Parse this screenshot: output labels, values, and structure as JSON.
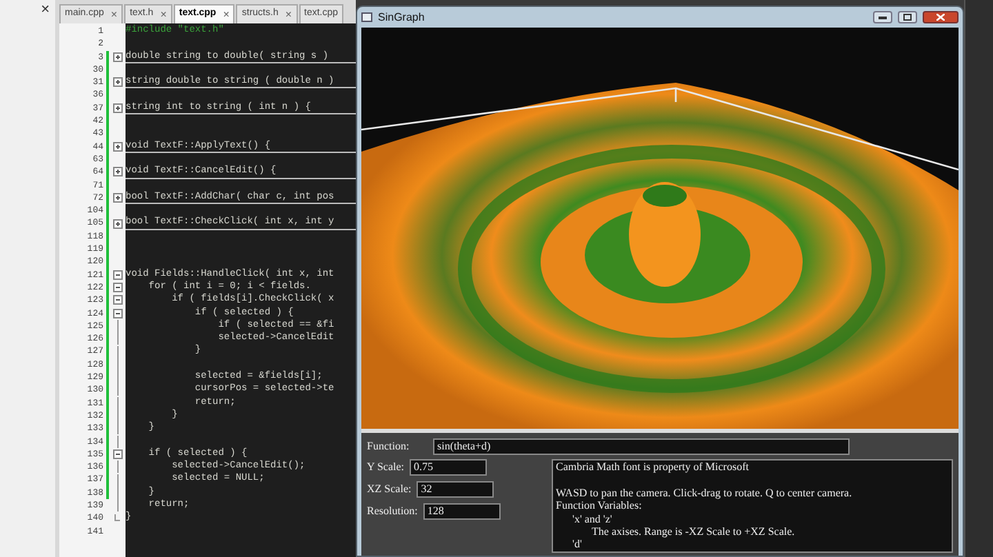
{
  "editor": {
    "close_label": "×",
    "tabs": [
      {
        "label": "main.cpp",
        "close": "×",
        "selected": false
      },
      {
        "label": "text.h",
        "close": "×",
        "selected": false
      },
      {
        "label": "text.cpp",
        "close": "×",
        "selected": true
      },
      {
        "label": "structs.h",
        "close": "×",
        "selected": false
      },
      {
        "label": "text.cpp",
        "selected": false
      }
    ],
    "lines": [
      {
        "n": "1",
        "code": "#include \"text.h\"",
        "kind": "preprocessor",
        "changed": false
      },
      {
        "n": "2",
        "kind": "plain",
        "changed": false
      },
      {
        "n": "3",
        "code": "double string to double( string s )",
        "kind": "collapsed",
        "changed": true
      },
      {
        "n": "30",
        "kind": "plain",
        "changed": true
      },
      {
        "n": "31",
        "code": "string double to string ( double n )",
        "kind": "collapsed",
        "changed": true
      },
      {
        "n": "36",
        "kind": "plain",
        "changed": true
      },
      {
        "n": "37",
        "code": "string int to string ( int n ) {",
        "kind": "collapsed",
        "changed": true
      },
      {
        "n": "42",
        "kind": "plain",
        "changed": true
      },
      {
        "n": "43",
        "kind": "plain",
        "changed": true
      },
      {
        "n": "44",
        "code": "void TextF::ApplyText() {",
        "kind": "collapsed",
        "changed": true
      },
      {
        "n": "63",
        "kind": "plain",
        "changed": true
      },
      {
        "n": "64",
        "code": "void TextF::CancelEdit() {",
        "kind": "collapsed",
        "changed": true
      },
      {
        "n": "71",
        "kind": "plain",
        "changed": true
      },
      {
        "n": "72",
        "code": "bool TextF::AddChar( char c, int pos",
        "kind": "collapsed",
        "changed": true
      },
      {
        "n": "104",
        "kind": "plain",
        "changed": true
      },
      {
        "n": "105",
        "code": "bool TextF::CheckClick( int x, int y",
        "kind": "collapsed",
        "changed": true
      },
      {
        "n": "118",
        "kind": "plain",
        "changed": true
      },
      {
        "n": "119",
        "kind": "plain",
        "changed": true
      },
      {
        "n": "120",
        "kind": "plain",
        "changed": true
      },
      {
        "n": "121",
        "code": "void Fields::HandleClick( int x, int",
        "kind": "expanded",
        "changed": true
      },
      {
        "n": "122",
        "code": "    for ( int i = 0; i < fields.",
        "kind": "expanded",
        "changed": true
      },
      {
        "n": "123",
        "code": "        if ( fields[i].CheckClick( x",
        "kind": "expanded",
        "changed": true
      },
      {
        "n": "124",
        "code": "            if ( selected ) {",
        "kind": "expanded",
        "changed": true
      },
      {
        "n": "125",
        "code": "                if ( selected == &fi",
        "kind": "nested",
        "changed": true
      },
      {
        "n": "126",
        "code": "                selected->CancelEdit",
        "kind": "nested",
        "changed": true
      },
      {
        "n": "127",
        "code": "            }",
        "kind": "nested",
        "changed": true
      },
      {
        "n": "128",
        "kind": "nested",
        "changed": true
      },
      {
        "n": "129",
        "code": "            selected = &fields[i];",
        "kind": "nested",
        "changed": true
      },
      {
        "n": "130",
        "code": "            cursorPos = selected->te",
        "kind": "nested",
        "changed": true
      },
      {
        "n": "131",
        "code": "            return;",
        "kind": "nested",
        "changed": true
      },
      {
        "n": "132",
        "code": "        }",
        "kind": "nested",
        "changed": true
      },
      {
        "n": "133",
        "code": "    }",
        "kind": "nested",
        "changed": true
      },
      {
        "n": "134",
        "kind": "nested",
        "changed": true
      },
      {
        "n": "135",
        "code": "    if ( selected ) {",
        "kind": "expanded",
        "changed": true
      },
      {
        "n": "136",
        "code": "        selected->CancelEdit();",
        "kind": "nested",
        "changed": true
      },
      {
        "n": "137",
        "code": "        selected = NULL;",
        "kind": "nested",
        "changed": true
      },
      {
        "n": "138",
        "code": "    }",
        "kind": "nested",
        "changed": true
      },
      {
        "n": "139",
        "code": "    return;",
        "kind": "nested",
        "changed": false
      },
      {
        "n": "140",
        "code": "}",
        "kind": "end",
        "changed": false
      },
      {
        "n": "141",
        "kind": "plain",
        "changed": false
      }
    ]
  },
  "graph_window": {
    "title": "SinGraph",
    "function": {
      "label": "Function:",
      "value": "sin(theta+d)"
    },
    "fields": [
      {
        "label": "Y Scale:",
        "value": "0.75"
      },
      {
        "label": "XZ Scale:",
        "value": "32"
      },
      {
        "label": "Resolution:",
        "value": "128"
      }
    ],
    "info_lines": [
      {
        "text": "Cambria Math font is property of Microsoft",
        "blank_before": false
      },
      {
        "text": "WASD to pan the camera. Click-drag to rotate. Q to center camera.",
        "blank_before": true
      },
      {
        "text": "Function Variables:",
        "blank_before": false
      },
      {
        "text": "'x' and 'z'",
        "blank_before": false
      },
      {
        "text": "The axises. Range is -XZ Scale to +XZ Scale.",
        "blank_before": false
      },
      {
        "text": "'d'",
        "blank_before": false
      }
    ]
  }
}
